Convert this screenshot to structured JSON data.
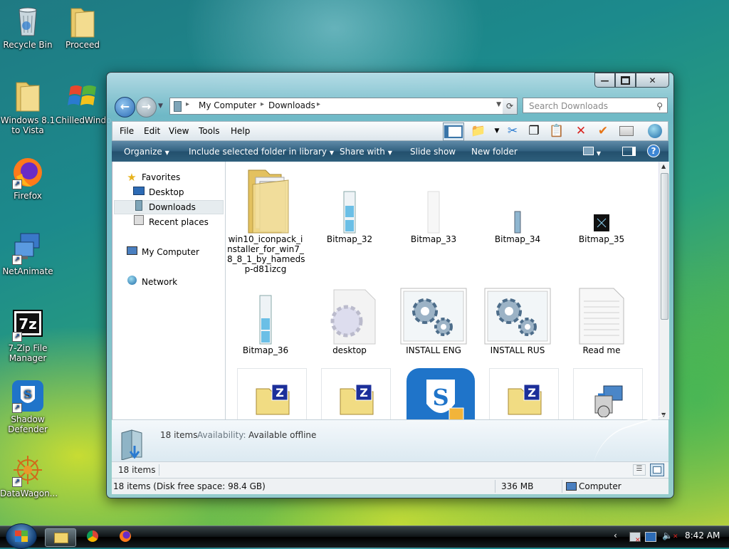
{
  "desktop": {
    "icons": [
      {
        "label": "Recycle Bin",
        "icon": "recycle-bin-icon"
      },
      {
        "label": "Proceed",
        "icon": "folder-icon"
      },
      {
        "label": "Windows 8.1 to Vista",
        "icon": "folder-icon"
      },
      {
        "label": "ChilledWindows",
        "icon": "windows-logo-icon"
      },
      {
        "label": "Firefox",
        "icon": "firefox-icon"
      },
      {
        "label": "NetAnimate",
        "icon": "network-computers-icon"
      },
      {
        "label": "7-Zip File Manager",
        "icon": "7zip-icon"
      },
      {
        "label": "Shadow Defender",
        "icon": "shadow-defender-icon"
      },
      {
        "label": "DataWagon...",
        "icon": "datawagon-icon"
      }
    ]
  },
  "window": {
    "caption_buttons": [
      "minimize",
      "maximize",
      "close"
    ],
    "address": {
      "segments": [
        "My Computer",
        "Downloads"
      ]
    },
    "search_placeholder": "Search Downloads",
    "menu": [
      "File",
      "Edit",
      "View",
      "Tools",
      "Help"
    ],
    "command_bar": {
      "organize": "Organize",
      "include": "Include selected folder in library",
      "share": "Share with",
      "slideshow": "Slide show",
      "new_folder": "New folder"
    },
    "nav_pane": {
      "favorites": "Favorites",
      "desktop": "Desktop",
      "downloads": "Downloads",
      "recent": "Recent places",
      "my_computer": "My Computer",
      "network": "Network"
    },
    "files": [
      {
        "name": "win10_iconpack_installer_for_win7_8_8_1_by_hamedsp-d81izcg",
        "lines": [
          "win10_iconpack_i",
          "nstaller_for_win7_",
          "8_8_1_by_hameds",
          "p-d81izcg"
        ],
        "icon": "folder-icon"
      },
      {
        "name": "Bitmap_32",
        "icon": "bitmap-icon"
      },
      {
        "name": "Bitmap_33",
        "icon": "bitmap-icon"
      },
      {
        "name": "Bitmap_34",
        "icon": "bitmap-icon"
      },
      {
        "name": "Bitmap_35",
        "icon": "bitmap-icon"
      },
      {
        "name": "Bitmap_36",
        "icon": "bitmap-icon"
      },
      {
        "name": "desktop",
        "icon": "settings-file-icon"
      },
      {
        "name": "INSTALL ENG",
        "icon": "gears-icon"
      },
      {
        "name": "INSTALL RUS",
        "icon": "gears-icon"
      },
      {
        "name": "Read me",
        "icon": "text-file-icon"
      },
      {
        "name": "",
        "icon": "zip-archive-icon"
      },
      {
        "name": "",
        "icon": "zip-archive-icon"
      },
      {
        "name": "",
        "icon": "shadow-defender-icon"
      },
      {
        "name": "",
        "icon": "zip-archive-icon"
      },
      {
        "name": "",
        "icon": "installer-icon"
      }
    ],
    "details_pane": {
      "count": "18 items",
      "availability_label": "Availability:",
      "availability_value": "Available offline"
    },
    "status_bar": {
      "items": "18 items"
    },
    "bottom_bar": {
      "disk": "18 items (Disk free space: 98.4 GB)",
      "size": "336 MB",
      "location": "Computer"
    }
  },
  "taskbar": {
    "time": "8:42 AM"
  }
}
